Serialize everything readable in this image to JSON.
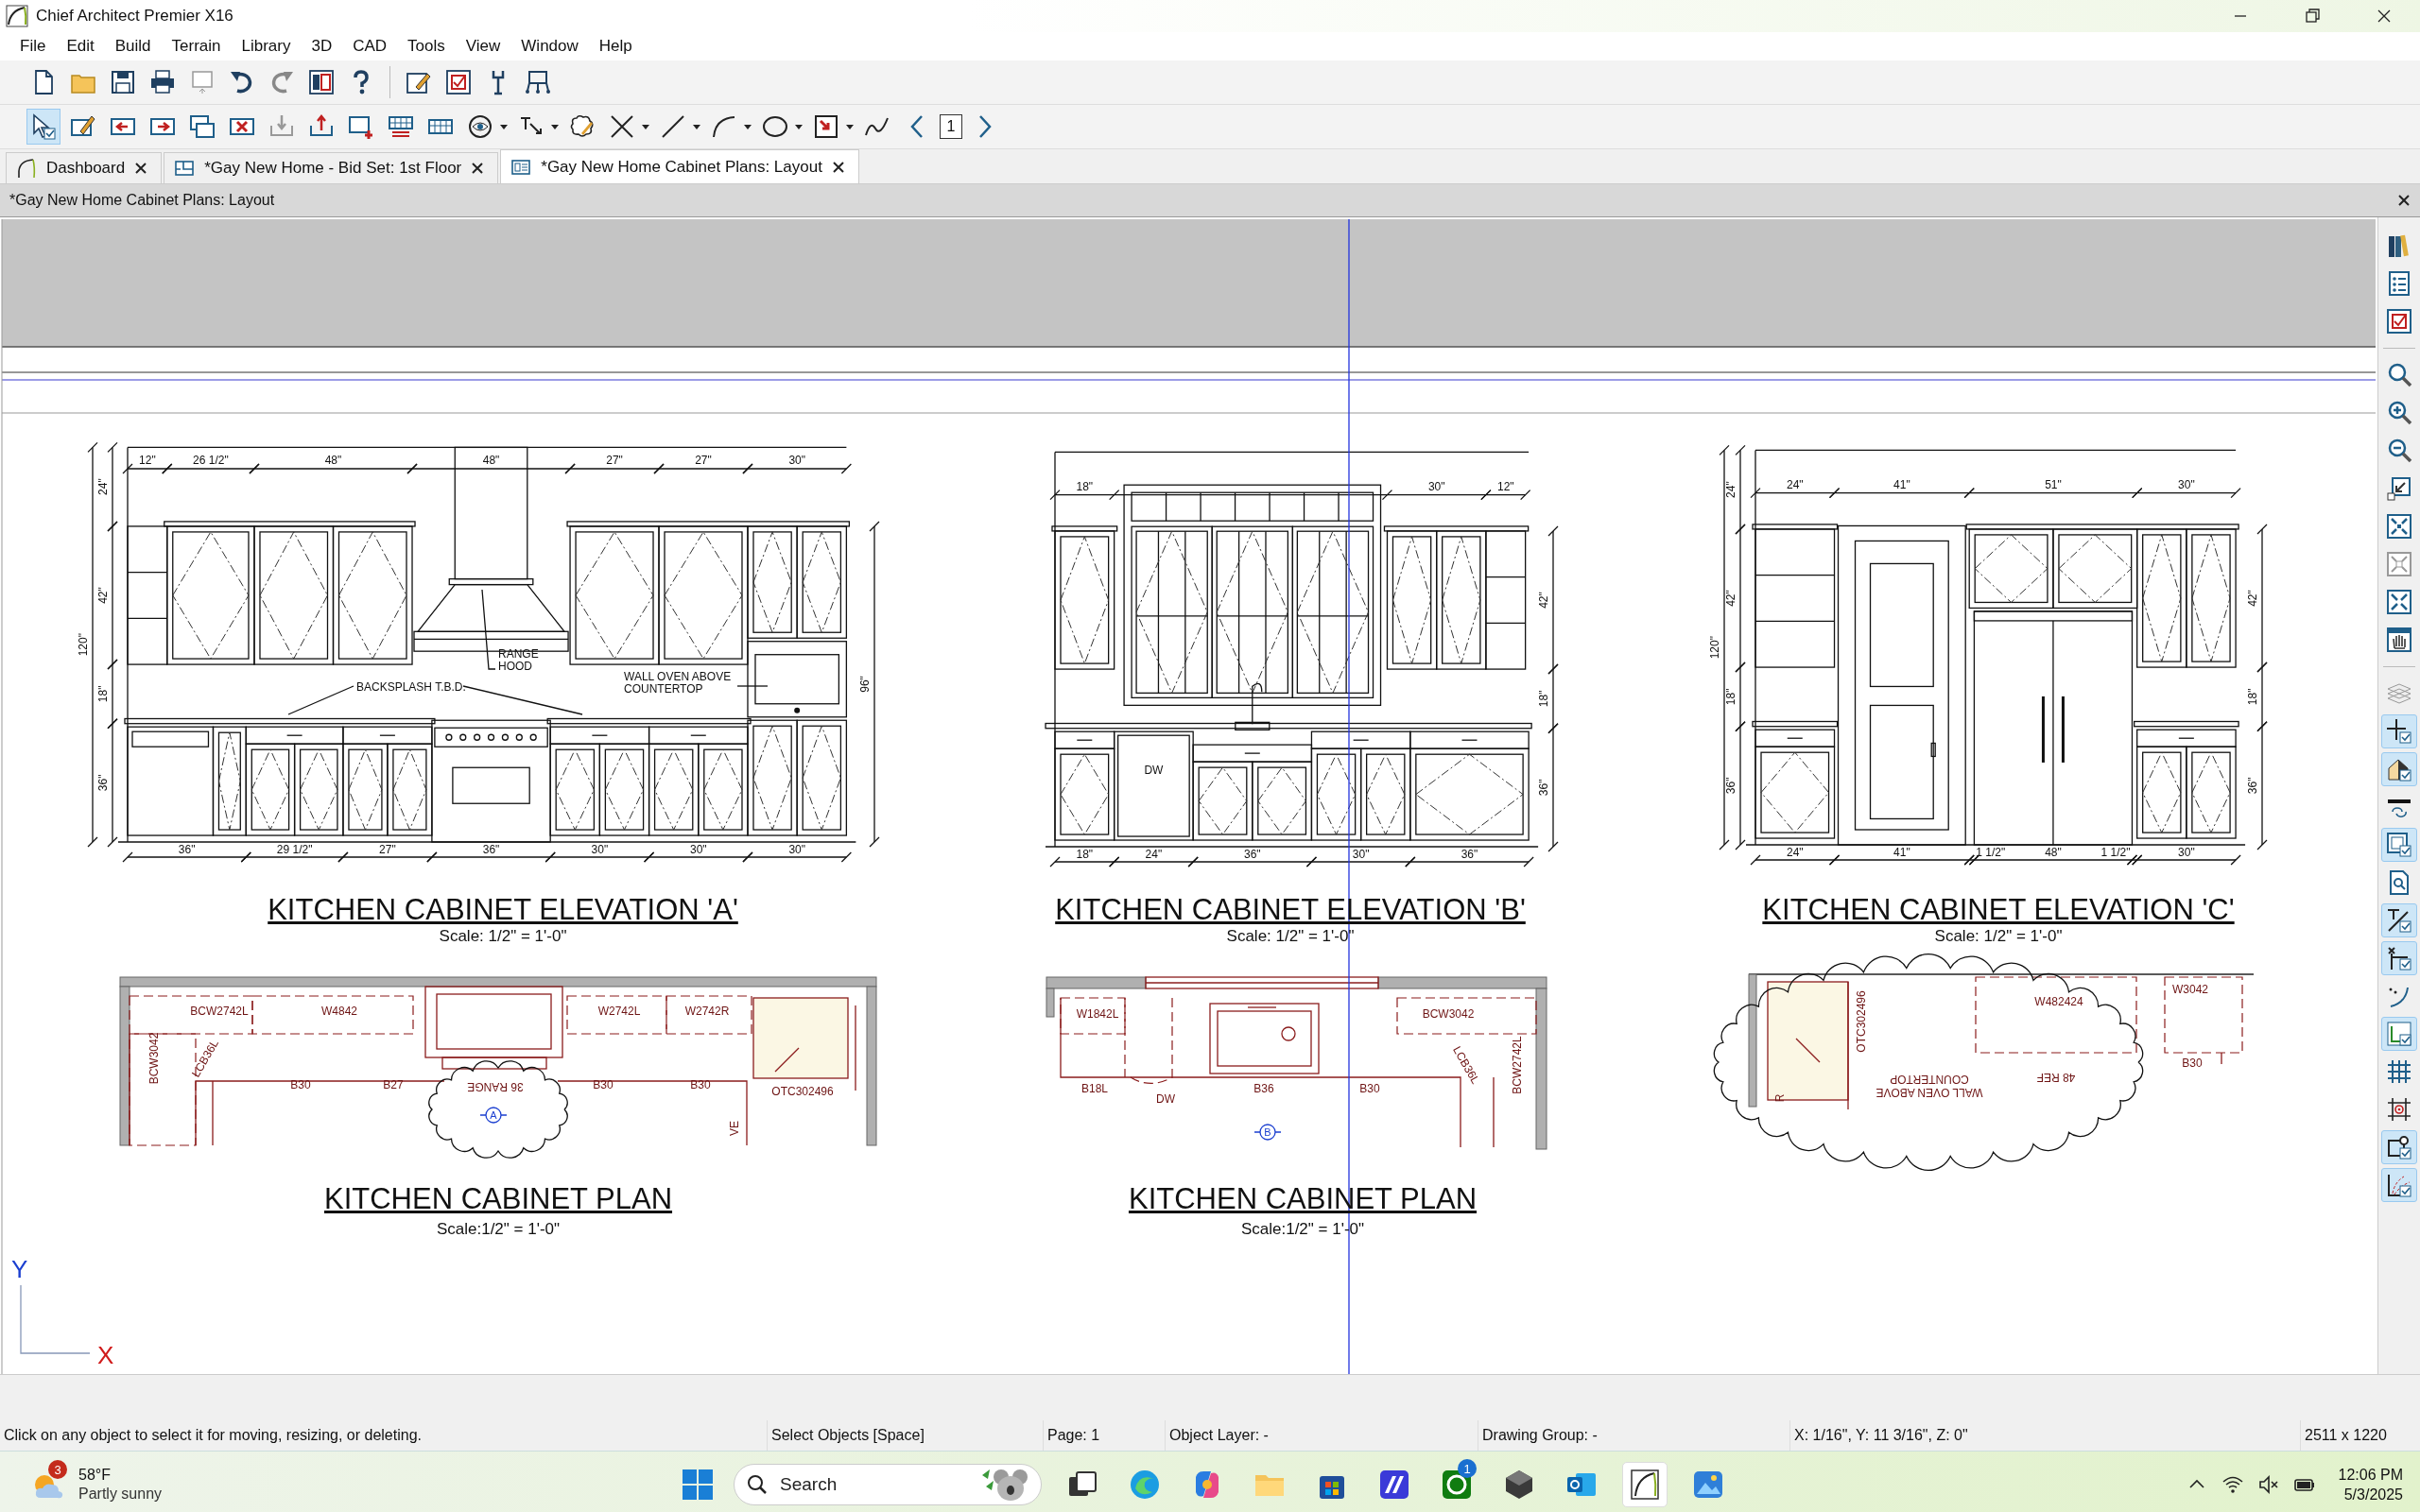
{
  "window": {
    "title": "Chief Architect Premier X16"
  },
  "menu": [
    "File",
    "Edit",
    "Build",
    "Terrain",
    "Library",
    "3D",
    "CAD",
    "Tools",
    "View",
    "Window",
    "Help"
  ],
  "select_tool": {
    "selected": true
  },
  "page_number": "1",
  "tabs": [
    {
      "label": "Dashboard",
      "kind": "dashboard",
      "selected": false
    },
    {
      "label": "*Gay New Home - Bid Set: 1st Floor",
      "kind": "plan",
      "selected": false
    },
    {
      "label": "*Gay New Home Cabinet Plans: Layout",
      "kind": "layout",
      "selected": true
    }
  ],
  "document": {
    "title": "*Gay New Home Cabinet Plans: Layout"
  },
  "elevations": [
    {
      "title": "KITCHEN CABINET ELEVATION 'A'",
      "scale": "Scale: 1/2\" = 1'-0\"",
      "top_dims": [
        "12\"",
        "26 1/2\"",
        "48\"",
        "48\"",
        "27\"",
        "27\"",
        "30\""
      ],
      "bottom_dims": [
        "36\"",
        "29 1/2\"",
        "27\"",
        "36\"",
        "30\"",
        "30\"",
        "30\""
      ],
      "left_dims": [
        "24\"",
        "42\"",
        "18\"",
        "36\"",
        "120\""
      ],
      "right_dims": [
        "96\""
      ],
      "callouts": [
        {
          "lines": [
            "RANGE",
            "HOOD"
          ]
        },
        {
          "lines": [
            "BACKSPLASH T.B.D."
          ]
        },
        {
          "lines": [
            "WALL OVEN ABOVE",
            "COUNTERTOP"
          ]
        }
      ]
    },
    {
      "title": "KITCHEN CABINET ELEVATION 'B'",
      "scale": "Scale: 1/2\" = 1'-0\"",
      "top_dims": [
        "18\"",
        "30\"",
        "12\""
      ],
      "bottom_dims": [
        "18\"",
        "24\"",
        "36\"",
        "30\"",
        "36\""
      ],
      "right_dims": [
        "42\"",
        "18\"",
        "36\""
      ],
      "appliance_labels": [
        "DW"
      ]
    },
    {
      "title": "KITCHEN CABINET ELEVATION 'C'",
      "scale": "Scale: 1/2\" = 1'-0\"",
      "top_dims": [
        "24\"",
        "41\"",
        "51\"",
        "30\""
      ],
      "bottom_dims": [
        "24\"",
        "41\"",
        "1 1/2\"",
        "48\"",
        "1 1/2\"",
        "30\""
      ],
      "left_dims": [
        "24\"",
        "42\"",
        "18\"",
        "36\"",
        "120\""
      ],
      "right_dims": [
        "42\"",
        "18\"",
        "36\""
      ]
    }
  ],
  "plans": [
    {
      "title": "KITCHEN CABINET PLAN",
      "scale": "Scale:1/2\" = 1'-0\"",
      "marker": "A",
      "labels": [
        "BCW2742L",
        "W4842",
        "W2742L",
        "W2742R",
        "BCW3042",
        "LCB36L",
        "B30",
        "B27",
        "36 RANGE",
        "B30",
        "B30",
        "OTC302496",
        "VE"
      ]
    },
    {
      "title": "KITCHEN CABINET PLAN",
      "scale": "Scale:1/2\" = 1'-0\"",
      "marker": "B",
      "labels": [
        "W1842L",
        "BCW3042",
        "LCB36L",
        "BCW2742L",
        "B18L",
        "DW",
        "B36",
        "B30"
      ]
    },
    {
      "labels": [
        "OTC302496",
        "W482424",
        "W3042",
        "B30",
        "48 REF",
        "WALL OVEN ABOVE",
        "COUNTERTOP",
        "R"
      ]
    }
  ],
  "axes": {
    "y": "Y",
    "x": "X"
  },
  "side_tools": [
    {
      "kind": "library",
      "checked": false
    },
    {
      "kind": "list",
      "checked": false
    },
    {
      "kind": "checklist",
      "checked": false
    },
    {
      "kind": "zoom",
      "checked": false
    },
    {
      "kind": "zoomin",
      "checked": false
    },
    {
      "kind": "zoomout",
      "checked": false
    },
    {
      "kind": "shrink",
      "checked": false
    },
    {
      "kind": "fill",
      "checked": false
    },
    {
      "kind": "fillgray",
      "checked": false
    },
    {
      "kind": "fit",
      "checked": false
    },
    {
      "kind": "pan",
      "checked": false
    },
    {
      "kind": "layers",
      "checked": false
    },
    {
      "kind": "cross",
      "checked": true
    },
    {
      "kind": "house",
      "checked": true
    },
    {
      "kind": "swap",
      "checked": false
    },
    {
      "kind": "window",
      "checked": true
    },
    {
      "kind": "pagesearch",
      "checked": false
    },
    {
      "kind": "dimension",
      "checked": true
    },
    {
      "kind": "point",
      "checked": true
    },
    {
      "kind": "arcsnap",
      "checked": false
    },
    {
      "kind": "axis",
      "checked": true
    },
    {
      "kind": "grid",
      "checked": false
    },
    {
      "kind": "gridtarget",
      "checked": false
    },
    {
      "kind": "objectsnap",
      "checked": true
    },
    {
      "kind": "angle",
      "checked": true
    }
  ],
  "status_bar": [
    "Click on any object to select it for moving, resizing, or deleting.",
    "Select Objects [Space]",
    "Page: 1",
    "Object Layer: -",
    "Drawing Group: -",
    "X: 1/16\", Y: 11 3/16\", Z: 0\"",
    "2511 x 1220"
  ],
  "taskbar": {
    "weather_badge": "3",
    "temperature": "58°F",
    "condition": "Partly sunny",
    "search": "Search",
    "xbox_badge": "1",
    "time": "12:06 PM",
    "date": "5/3/2025"
  }
}
